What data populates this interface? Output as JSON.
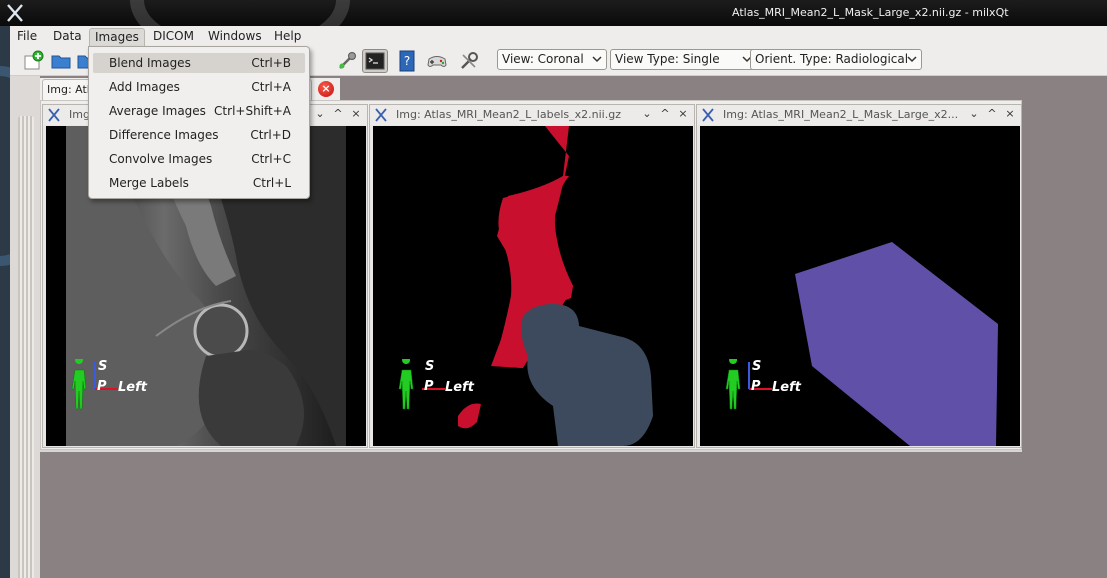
{
  "window": {
    "title": "Atlas_MRI_Mean2_L_Mask_Large_x2.nii.gz - milxQt"
  },
  "menubar": {
    "items": [
      {
        "label": "File"
      },
      {
        "label": "Data"
      },
      {
        "label": "Images"
      },
      {
        "label": "DICOM"
      },
      {
        "label": "Windows"
      },
      {
        "label": "Help"
      }
    ]
  },
  "images_menu": {
    "items": [
      {
        "label": "Blend Images",
        "shortcut": "Ctrl+B"
      },
      {
        "label": "Add Images",
        "shortcut": "Ctrl+A"
      },
      {
        "label": "Average Images",
        "shortcut": "Ctrl+Shift+A"
      },
      {
        "label": "Difference Images",
        "shortcut": "Ctrl+D"
      },
      {
        "label": "Convolve Images",
        "shortcut": "Ctrl+C"
      },
      {
        "label": "Merge Labels",
        "shortcut": "Ctrl+L"
      }
    ]
  },
  "toolbar": {
    "view": "View: Coronal",
    "view_type": "View Type: Single",
    "orient_type": "Orient. Type: Radiological"
  },
  "tabbar": {
    "tab_label": "Img: Atlas_MRI_Mean2_L_Mask_Large_x2.nii.gz"
  },
  "windows": [
    {
      "title": "Img:"
    },
    {
      "title": "Img: Atlas_MRI_Mean2_L_labels_x2.nii.gz"
    },
    {
      "title": "Img: Atlas_MRI_Mean2_L_Mask_Large_x2..."
    }
  ],
  "orientation": {
    "superior": "S",
    "posterior": "P",
    "left": "Left"
  },
  "colors": {
    "label_red": "#c8102e",
    "label_slate": "#3d4a5e",
    "mask_purple": "#6050a8",
    "marker_green": "#22cc22"
  }
}
